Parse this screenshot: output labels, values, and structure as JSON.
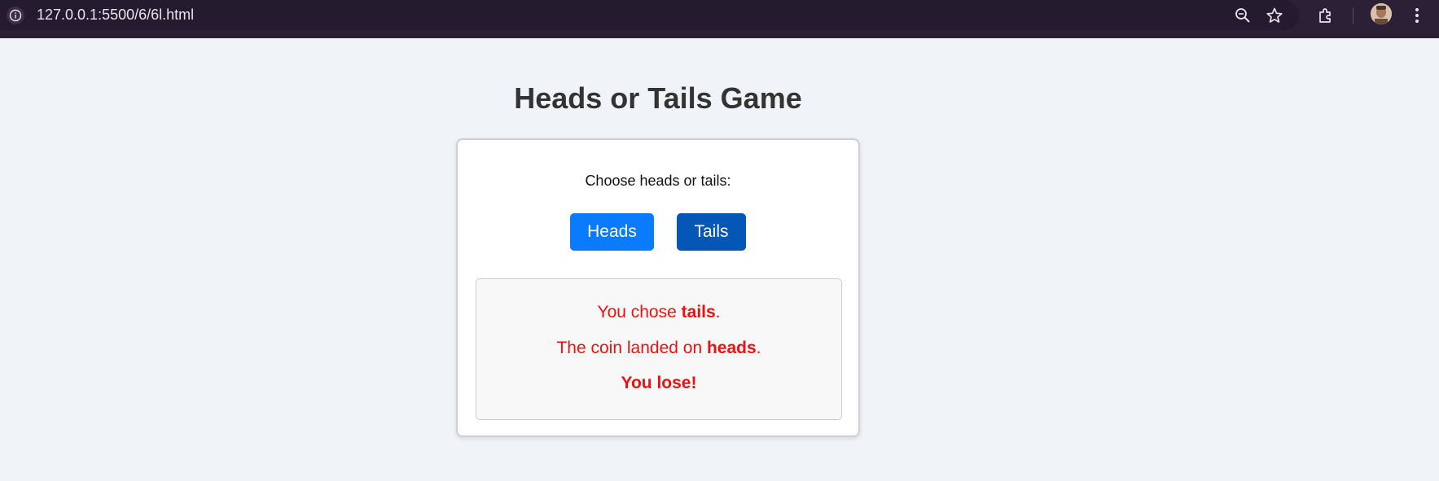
{
  "browser": {
    "url": "127.0.0.1:5500/6/6l.html",
    "icons": [
      "info-icon",
      "zoom-out-icon",
      "bookmark-star-icon",
      "extensions-icon",
      "profile-avatar",
      "menu-kebab-icon"
    ]
  },
  "page": {
    "title": "Heads or Tails Game",
    "prompt": "Choose heads or tails:",
    "buttons": {
      "heads_label": "Heads",
      "tails_label": "Tails"
    },
    "result": {
      "choice_prefix": "You chose ",
      "choice_value": "tails",
      "choice_suffix": ".",
      "coin_prefix": "The coin landed on ",
      "coin_value": "heads",
      "coin_suffix": ".",
      "outcome": "You lose!"
    }
  },
  "colors": {
    "heads_button": "#0a7bfd",
    "tails_button": "#0456b7",
    "result_text": "#ee1111",
    "page_background": "#f0f3f7"
  }
}
